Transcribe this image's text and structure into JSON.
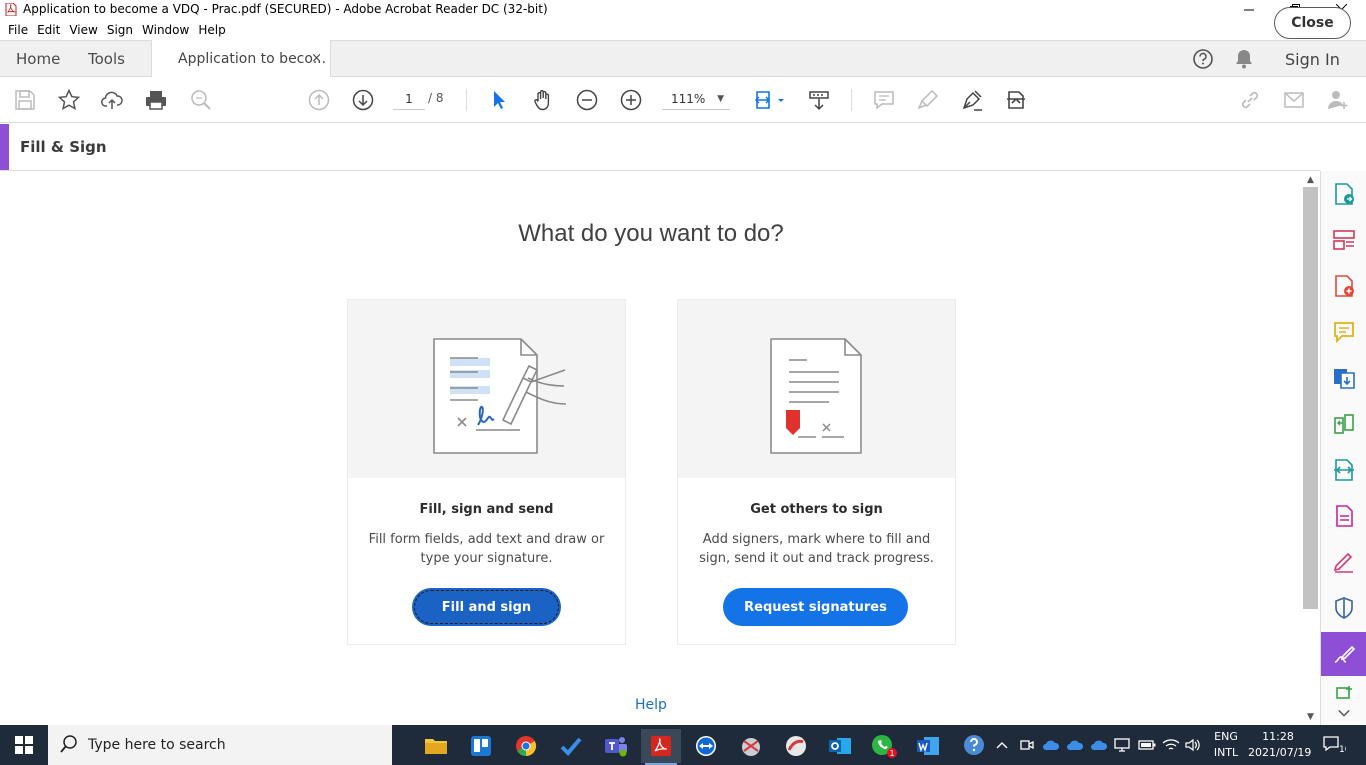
{
  "window": {
    "title": "Application to become a VDQ - Prac.pdf (SECURED) - Adobe Acrobat Reader DC (32-bit)"
  },
  "menu": [
    "File",
    "Edit",
    "View",
    "Sign",
    "Window",
    "Help"
  ],
  "tabs": {
    "home": "Home",
    "tools": "Tools",
    "document": "Application to beco...",
    "close_glyph": "×",
    "sign_in": "Sign In"
  },
  "toolbar": {
    "page_current": "1",
    "page_total": "/ 8",
    "zoom": "111%"
  },
  "fill_sign": {
    "title": "Fill & Sign",
    "close": "Close",
    "accent_color": "#8e4fd6"
  },
  "main": {
    "question": "What do you want to do?",
    "cards": [
      {
        "title": "Fill, sign and send",
        "description": "Fill form fields, add text and draw or type your signature.",
        "button": "Fill and sign"
      },
      {
        "title": "Get others to sign",
        "description": "Add signers, mark where to fill and sign, send it out and track progress.",
        "button": "Request signatures"
      }
    ],
    "help": "Help",
    "button_color": "#1473e6"
  },
  "taskbar": {
    "search_placeholder": "Type here to search",
    "lang_line1": "ENG",
    "lang_line2": "INTL",
    "time": "11:28",
    "date": "2021/07/19",
    "notification_count": "10",
    "whatsapp_badge": "1"
  }
}
